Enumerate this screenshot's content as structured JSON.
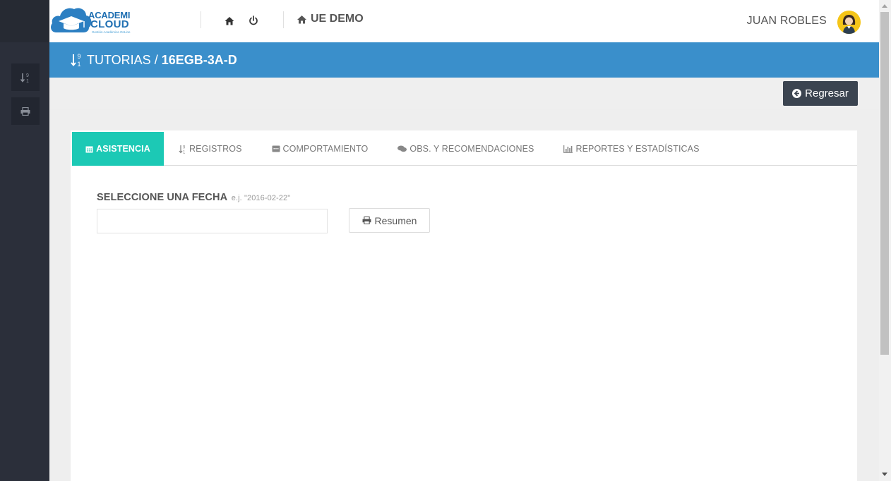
{
  "header": {
    "logo": {
      "line1": "ACADEMI",
      "line2": "CLOUD",
      "tagline": "Gestión Académica OnLine"
    },
    "icons": [
      "home-icon",
      "power-icon"
    ],
    "school_icon": "home-icon",
    "school_name": "UE DEMO",
    "user_name": "JUAN ROBLES"
  },
  "sidebar": {
    "items": [
      {
        "icon": "sort-numeric-icon"
      },
      {
        "icon": "print-icon"
      }
    ]
  },
  "titlebar": {
    "icon": "sort-numeric-icon",
    "section": "TUTORIAS",
    "separator": " / ",
    "course": "16EGB-3A-D"
  },
  "actions": {
    "back_label": "Regresar",
    "back_icon": "arrow-circle-left-icon"
  },
  "tabs": [
    {
      "label": "ASISTENCIA",
      "icon": "calendar-icon",
      "active": true
    },
    {
      "label": "REGISTROS",
      "icon": "sort-numeric-icon",
      "active": false
    },
    {
      "label": "COMPORTAMIENTO",
      "icon": "comment-box-icon",
      "active": false
    },
    {
      "label": "OBS. Y RECOMENDACIONES",
      "icon": "comments-icon",
      "active": false
    },
    {
      "label": "REPORTES Y ESTADÍSTICAS",
      "icon": "bar-chart-icon",
      "active": false
    }
  ],
  "form": {
    "date_label": "SELECCIONE UNA FECHA",
    "date_hint": "e.j. \"2016-02-22\"",
    "date_value": "",
    "summary_label": "Resumen"
  },
  "colors": {
    "sidebar": "#2b2f3a",
    "titlebar": "#3a8fcb",
    "active_tab": "#1cc9b5",
    "back_button": "#3b4450"
  }
}
